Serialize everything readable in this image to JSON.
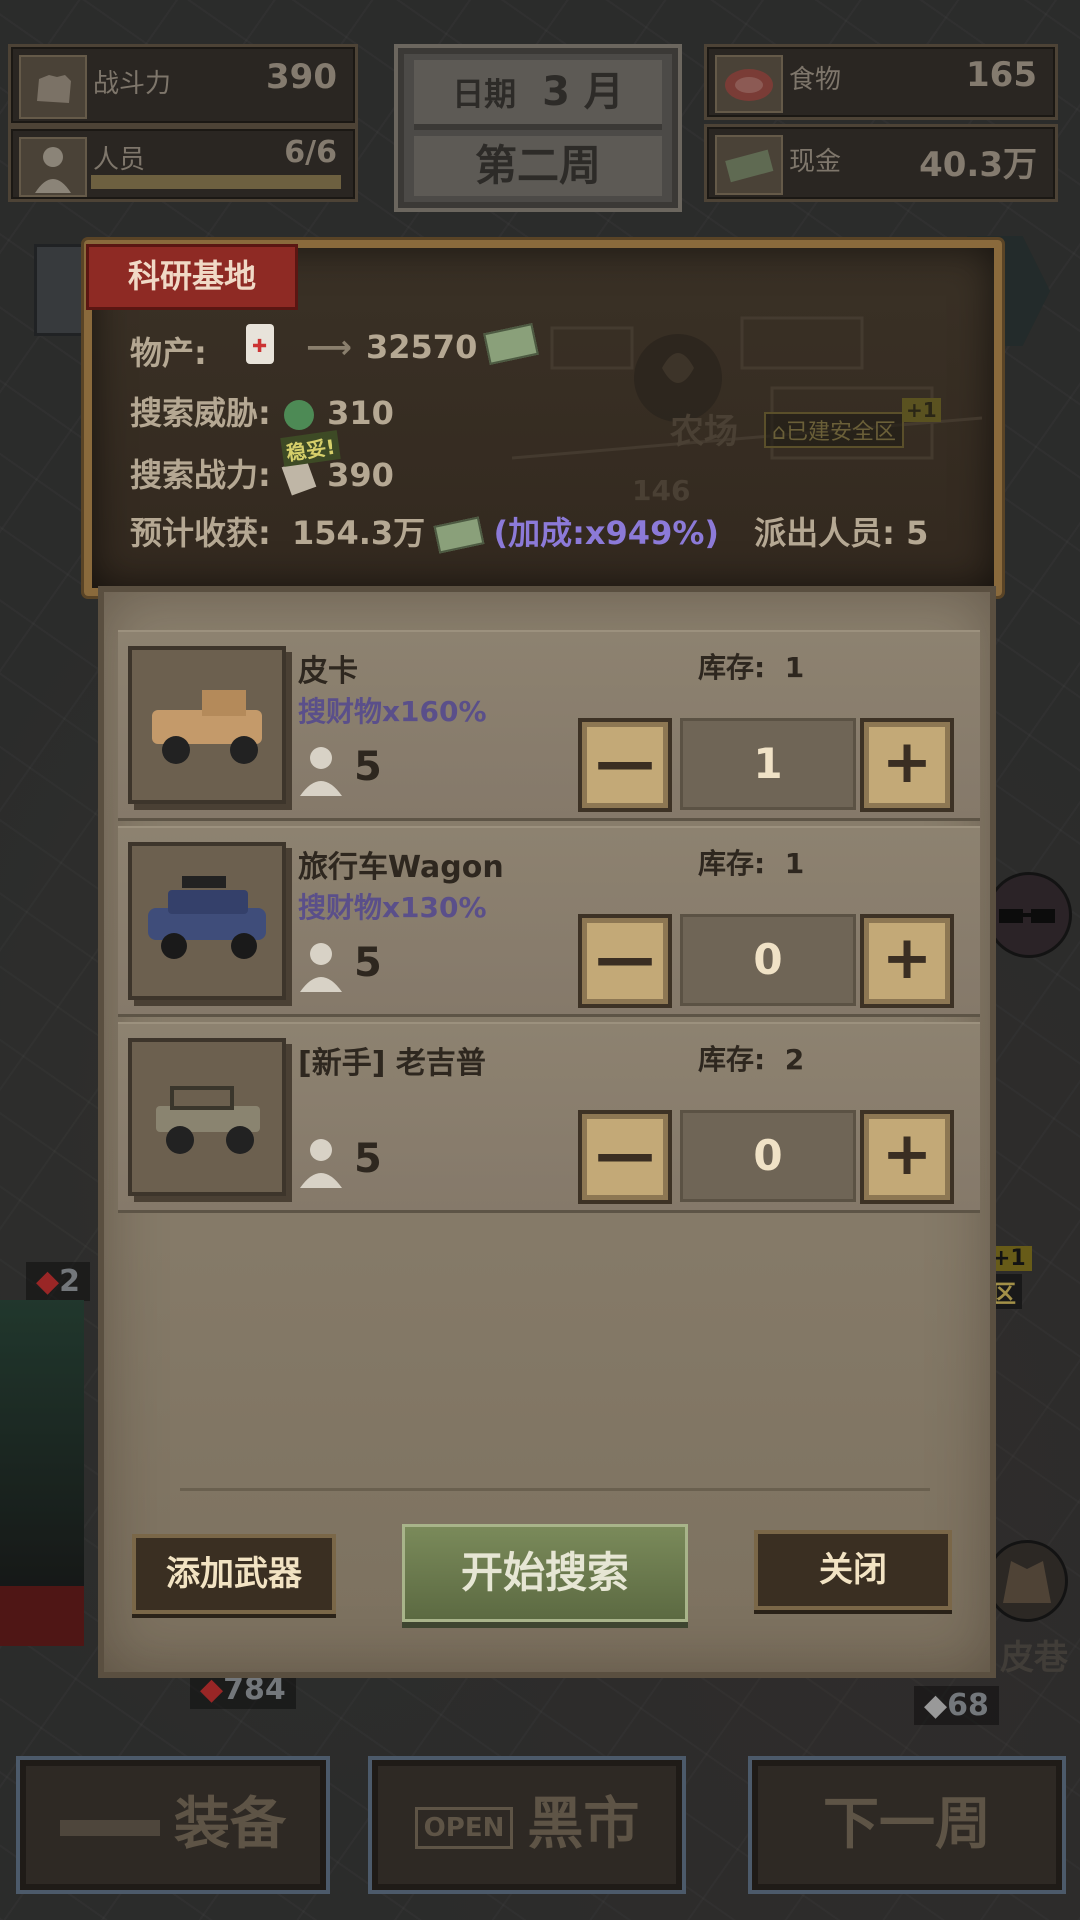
{
  "hud": {
    "combat": {
      "label": "战斗力",
      "value": "390"
    },
    "members": {
      "label": "人员",
      "value": "6/6"
    },
    "food": {
      "label": "食物",
      "value": "165"
    },
    "cash": {
      "label": "现金",
      "value": "40.3万"
    },
    "date": {
      "label": "日期",
      "month": "3 月",
      "week": "第二周"
    }
  },
  "map": {
    "farm_label": "农场",
    "safe_zone": "已建安全区",
    "plus_one": "+1",
    "farm_threat": "146",
    "left_threat": "2",
    "bottom_left_threat": "784",
    "bottom_right_threat": "68",
    "right_zone_fragment": "区",
    "right_label_fragment": "皮巷"
  },
  "dialog": {
    "location_tag": "科研基地",
    "produce_label": "物产:",
    "produce_value": "32570",
    "threat_label": "搜索威胁:",
    "threat_value": "310",
    "power_label": "搜索战力:",
    "power_badge": "稳妥!",
    "power_value": "390",
    "harvest_label": "预计收获:",
    "harvest_value": "154.3万",
    "bonus_text": "(加成:x949%)",
    "dispatch_label": "派出人员:",
    "dispatch_value": "5",
    "vehicles": [
      {
        "name": "皮卡",
        "bonus": "搜财物x160%",
        "stock_label": "库存:",
        "stock": "1",
        "crew": "5",
        "qty": "1"
      },
      {
        "name": "旅行车Wagon",
        "bonus": "搜财物x130%",
        "stock_label": "库存:",
        "stock": "1",
        "crew": "5",
        "qty": "0"
      },
      {
        "name": "[新手] 老吉普",
        "bonus": "",
        "stock_label": "库存:",
        "stock": "2",
        "crew": "5",
        "qty": "0"
      }
    ],
    "minus_glyph": "—",
    "plus_glyph": "+",
    "add_weapon": "添加武器",
    "start_search": "开始搜索",
    "close": "关闭"
  },
  "bottom": {
    "equip": "装备",
    "market": "黑市",
    "market_sign": "OPEN",
    "next_week": "下一周"
  },
  "colors": {
    "panel_border": "#8a6a3c",
    "red_tag": "#8e2a24",
    "bonus_purple": "#8c7ad8",
    "start_green": "#6b7a4e"
  }
}
